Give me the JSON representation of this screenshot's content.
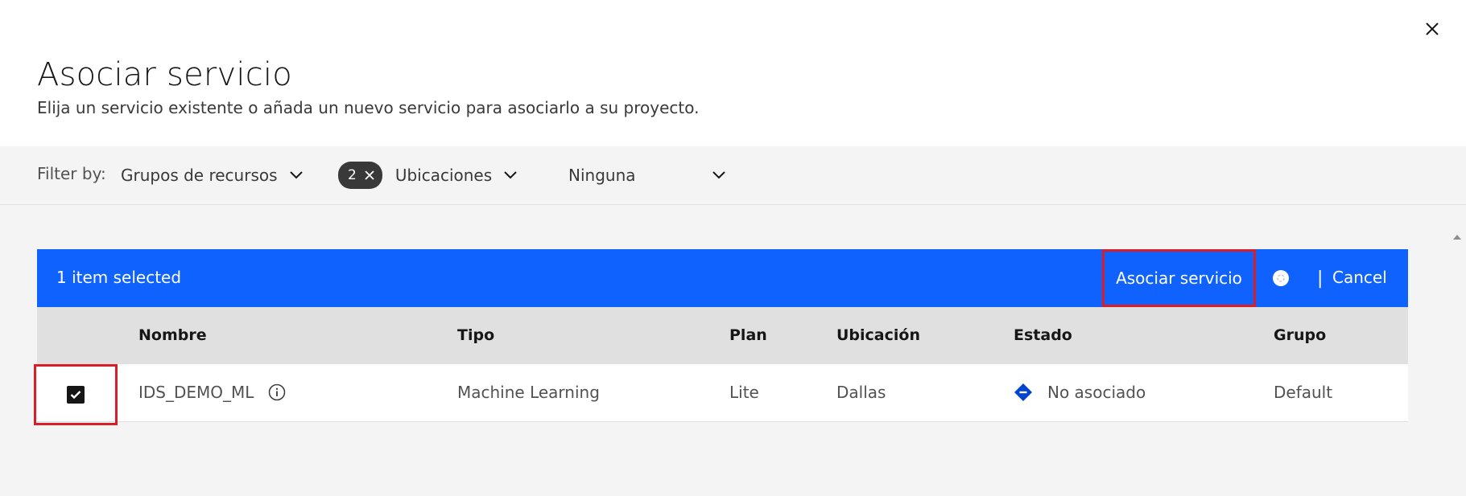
{
  "dialog": {
    "title": "Asociar servicio",
    "subtitle": "Elija un servicio existente o añada un nuevo servicio para asociarlo a su proyecto.",
    "close_icon": "close-icon"
  },
  "filters": {
    "label": "Filter by:",
    "resource_groups": "Grupos de recursos",
    "tag_count": "2",
    "locations": "Ubicaciones",
    "none": "Ninguna"
  },
  "batch": {
    "summary": "1 item selected",
    "associate": "Asociar servicio",
    "separator": "|",
    "cancel": "Cancel"
  },
  "table": {
    "columns": [
      "Nombre",
      "Tipo",
      "Plan",
      "Ubicación",
      "Estado",
      "Grupo"
    ],
    "rows": [
      {
        "selected": true,
        "name": "IDS_DEMO_ML",
        "type": "Machine Learning",
        "plan": "Lite",
        "location": "Dallas",
        "status": "No asociado",
        "group": "Default"
      }
    ]
  },
  "colors": {
    "accent": "#0f62fe",
    "highlight": "#da1e28",
    "status_icon": "#0043ce"
  }
}
